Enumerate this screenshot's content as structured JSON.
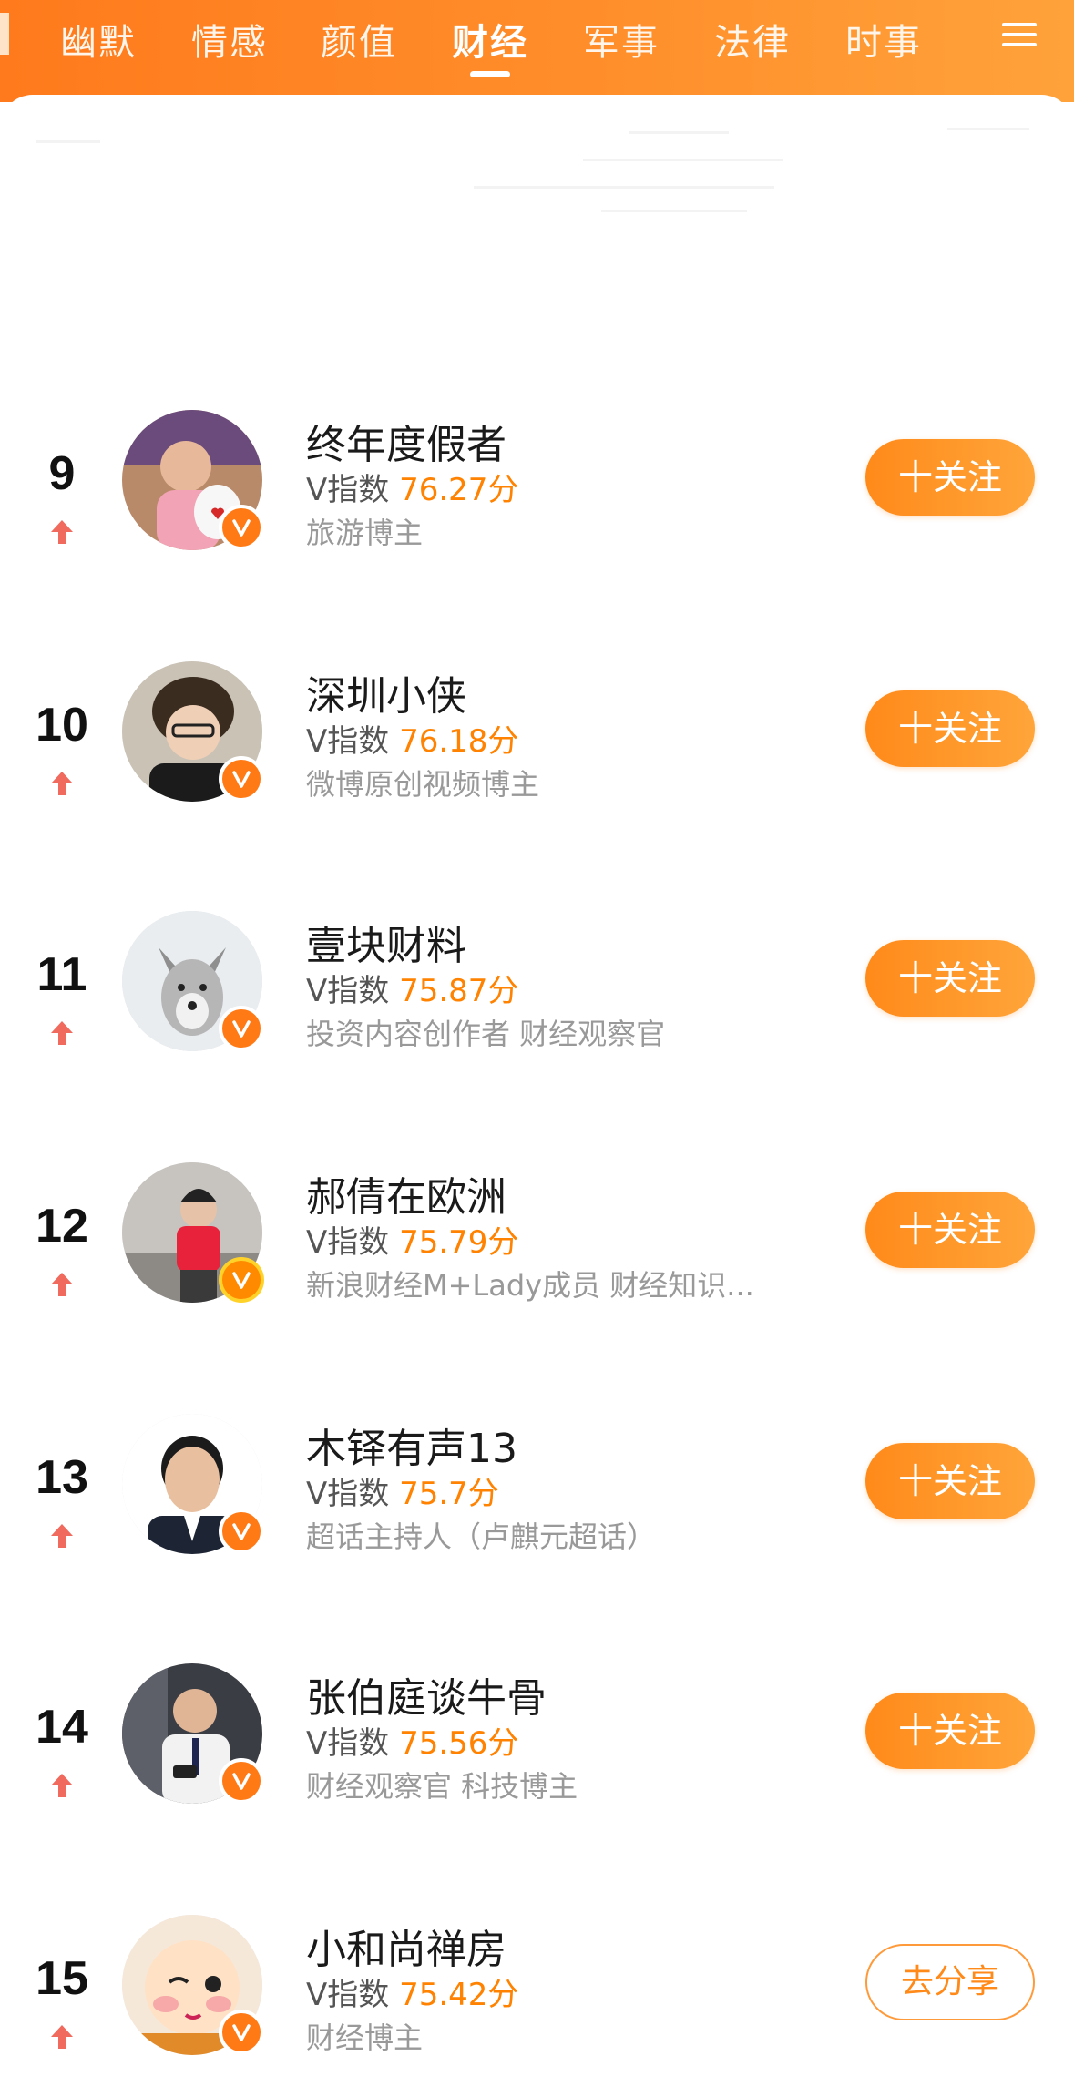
{
  "tabs": [
    "幽默",
    "情感",
    "颜值",
    "财经",
    "军事",
    "法律",
    "时事"
  ],
  "active_tab": "财经",
  "score_prefix": "V指数",
  "score_suffix": "分",
  "accent_color": "#ff8200",
  "list": [
    {
      "rank": "9",
      "trend": "up",
      "name": "终年度假者",
      "score": "76.27",
      "desc": "旅游博主",
      "action": "十关注"
    },
    {
      "rank": "10",
      "trend": "up",
      "name": "深圳小侠",
      "score": "76.18",
      "desc": "微博原创视频博主",
      "action": "十关注"
    },
    {
      "rank": "11",
      "trend": "up",
      "name": "壹块财料",
      "score": "75.87",
      "desc": "投资内容创作者 财经观察官",
      "action": "十关注"
    },
    {
      "rank": "12",
      "trend": "up",
      "name": "郝倩在欧洲",
      "score": "75.79",
      "desc": "新浪财经M+Lady成员 财经知识...",
      "action": "十关注"
    },
    {
      "rank": "13",
      "trend": "up",
      "name": "木铎有声13",
      "score": "75.7",
      "desc": "超话主持人（卢麒元超话）",
      "action": "十关注"
    },
    {
      "rank": "14",
      "trend": "up",
      "name": "张伯庭谈牛骨",
      "score": "75.56",
      "desc": "财经观察官 科技博主",
      "action": "十关注"
    },
    {
      "rank": "15",
      "trend": "up",
      "name": "小和尚禅房",
      "score": "75.42",
      "desc": "财经博主",
      "action": "去分享"
    }
  ]
}
